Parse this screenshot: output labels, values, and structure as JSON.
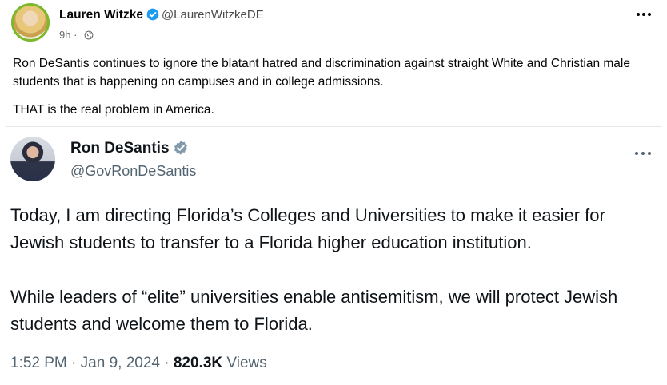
{
  "post": {
    "author_name": "Lauren Witzke",
    "author_handle": "@LaurenWitzkeDE",
    "time": "9h",
    "more_icon": "more-horizontal-icon",
    "text": [
      "Ron DeSantis continues to ignore the blatant hatred and discrimination against straight White and Christian male students that is happening on campuses and in college admissions.",
      "THAT is the real problem in America."
    ]
  },
  "quoted": {
    "author_name": "Ron DeSantis",
    "author_handle": "@GovRonDeSantis",
    "more_icon": "more-horizontal-icon",
    "text": [
      "Today, I am directing Florida’s Colleges and Universities to make it easier for Jewish students to transfer to a Florida higher education institution.",
      "While leaders of “elite” universities enable antisemitism, we will protect Jewish students and welcome them to Florida."
    ],
    "time": "1:52 PM",
    "separator": "·",
    "date": "Jan 9, 2024",
    "views_count": "820.3K",
    "views_label": "Views"
  },
  "colors": {
    "verified_blue": "#1d9bf0",
    "verified_gray": "#829aab"
  }
}
